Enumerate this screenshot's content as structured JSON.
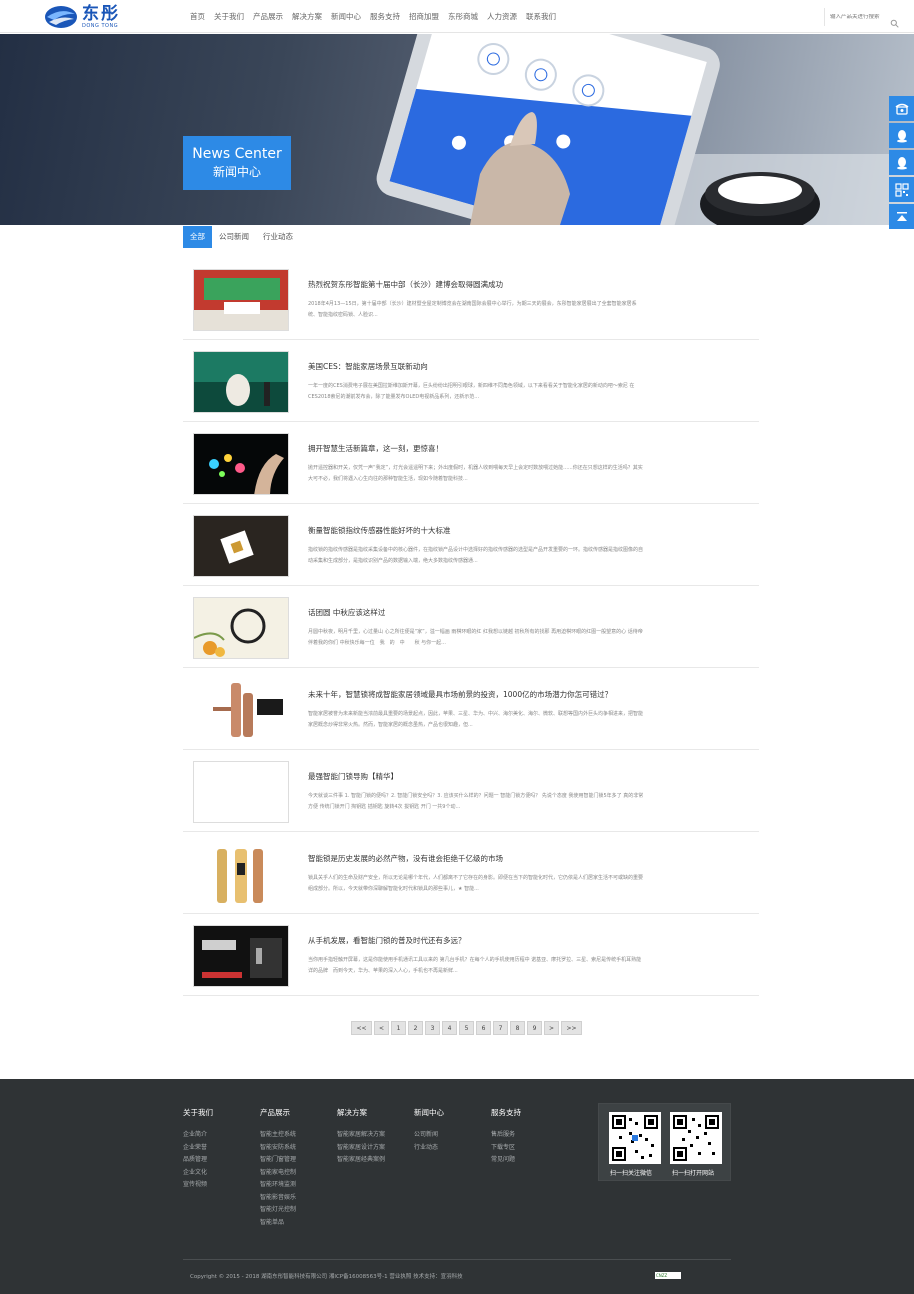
{
  "header": {
    "logo_cn": "东彤",
    "logo_en": "DONG TONG",
    "nav": [
      "首页",
      "关于我们",
      "产品展示",
      "解决方案",
      "新闻中心",
      "服务支持",
      "招商加盟",
      "东彤商城",
      "人力资源",
      "联系我们"
    ],
    "search_placeholder": "输入产品关进行搜索"
  },
  "banner": {
    "title_en": "News Center",
    "title_cn": "新闻中心"
  },
  "tabs": [
    "全部",
    "公司新闻",
    "行业动态"
  ],
  "news": [
    {
      "title": "热烈祝贺东彤智能第十届中部（长沙）建博会取得圆满成功",
      "desc": "2018年4月13—15日，第十届中部（长沙）建材暨全屋定制博览会在湖南国际会展中心举行，为期三天的展会，东彤智能家居展出了全套智能家居系统、智能指纹密码锁、人脸识..."
    },
    {
      "title": "美国CES：智能家居场景互联新动向",
      "desc": "一年一度的CES消费电子展在美国拉斯维加斯开幕，巨头纷纷出招明引眼球，新四维不同角色领域，以下来看看关于智能化家居的新动向吧～索尼 在CES2018索尼的潮前发布会，除了能量发布OLED电视新品系列，还新示范..."
    },
    {
      "title": "拥开智慧生活新篇章，这一刻，更惊喜！",
      "desc": "抛开遥控器和开关，仅凭一声“我定”，灯光会遥遥明下来；外出度假时，机器人收到喂每天早上会定时数放喂过她能......你还在只想这样的生活吗？其实大可不必，我们将遇入心生向往的那种智能生活，现如今随着智能科技..."
    },
    {
      "title": "衡量智能锁指纹传感器性能好坏的十大标准",
      "desc": "指纹锁的指纹传感器是指纹采集设备中的核心器件，在指纹锁产品设计中选择好的指纹传感器的选型是产品开发重要的一环。指纹传感器是指纹图像的自动采集和生成部分，是指纹识别产品的数据输入端，绝大多数指纹传感器通..."
    },
    {
      "title": "话团圆 中秋应该这样过",
      "desc": "月圆中秋夜，明月千里，心过量山 心之所往便是“家”，溢一幅画 雨棋环眼的红 红我想以链越 初秋所有的找那 再用迫棋环眼的红图一般望意的心 话待帝伴着我的你们 中秋快乐每一位　我　的　中　　秋 与你一起..."
    },
    {
      "title": "未来十年，智慧锁将成智能家居领域最具市场前景的投资，1000亿的市场潜力你怎可错过？",
      "desc": "智能家居被誉为未来新能当浓前最具重要的场景起点，因此，苹果、三星、华为、中兴、海尔美化、海尔、微软、联想等国内外巨头均争相进来，把智能家居概念炒得非常火热。然而，智能家居的概念虽热，产品也很知趣，但..."
    },
    {
      "title": "最强智能门锁导购【精华】",
      "desc": "今天就谈三件事 1. 智能门锁的便吗？2. 智能门锁安全吗？3. 应该买什么样的？问题一 智能门锁方便吗？ 先说个态度 我使用智能门锁5年多了 真的非常方便 传统门锁开门 掏钥匙 插钥匙 旋转4次 拔钥匙 开门 一共9个动..."
    },
    {
      "title": "智能锁是历史发展的必然产物，没有谁会拒绝千亿级的市场",
      "desc": "锁具关乎人们的生命及财产安全，所以无论是哪个年代，人们都离不了它存在的身影。即便在当下的智能化时代，它仍依是人们居家生活不可或缺的重要组成部分。所以，今天就带你深聊解智能化时代和锁具的那些事儿，★ 智能..."
    },
    {
      "title": "从手机发展，看智能门锁的普及时代还有多远？",
      "desc": "当你用手指轻触开屏幕，这是你能使用手机通讯工具以来的 第几台手机？在每个人的手机使用历程中 诺基亚、摩托罗拉、三星、索尼是传统手机耳熟能详的品牌　而到今天，华为、苹果的深入人心，手机也不再是新鲜..."
    }
  ],
  "pager": [
    "<<",
    "<",
    "1",
    "2",
    "3",
    "4",
    "5",
    "6",
    "7",
    "8",
    "9",
    ">",
    ">>"
  ],
  "footer": {
    "cols": [
      {
        "title": "关于我们",
        "links": [
          "企业简介",
          "企业荣誉",
          "品质管理",
          "企业文化",
          "宣传视频"
        ]
      },
      {
        "title": "产品展示",
        "links": [
          "智能主控系统",
          "智能安防系统",
          "智能门窗管理",
          "智能家电控制",
          "智能环境监测",
          "智能影音娱乐",
          "智能灯光控制",
          "智能单品"
        ]
      },
      {
        "title": "解决方案",
        "links": [
          "智能家居解决方案",
          "智能家居设计方案",
          "智能家居经典案例"
        ]
      },
      {
        "title": "新闻中心",
        "links": [
          "公司新闻",
          "行业动态"
        ]
      },
      {
        "title": "服务支持",
        "links": [
          "售后服务",
          "下载专区",
          "常见问题"
        ]
      }
    ],
    "qr1": "扫一扫关注微信",
    "qr2": "扫一扫打开网站",
    "copyright": "Copyright © 2015 - 2018 湖南东彤智能科技有限公司  湘ICP备16008563号-1  营业执照  技术支持：宣羽科技",
    "cnzz": "CNZZ"
  }
}
